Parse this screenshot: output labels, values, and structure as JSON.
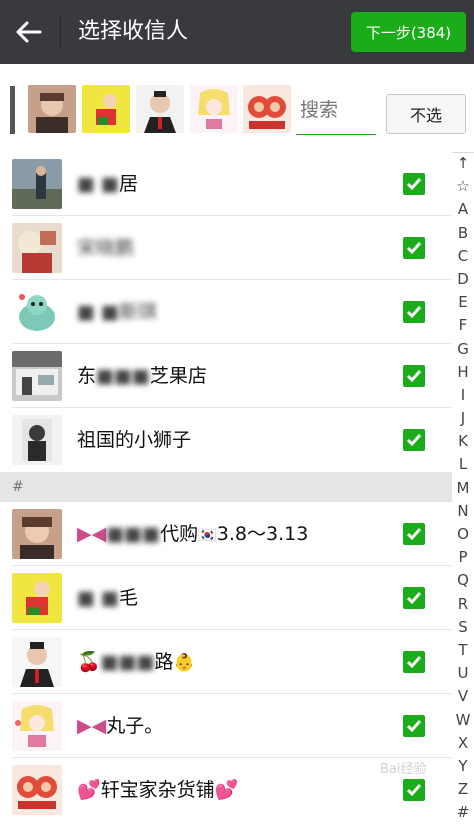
{
  "header": {
    "back_icon": "back-arrow-icon",
    "title": "选择收信人",
    "next_label": "下一步(384)"
  },
  "selected_bar": {
    "search_placeholder": "搜索",
    "deselect_label": "不选"
  },
  "contacts_top": [
    {
      "name": "██居",
      "checked": true
    },
    {
      "name": "宋晓鹏",
      "checked": true
    },
    {
      "name": "██斯琪",
      "checked": true
    },
    {
      "name": "东███芝果店",
      "checked": true
    },
    {
      "name": "祖国的小狮子",
      "checked": true
    }
  ],
  "section_header": "#",
  "contacts_hash": [
    {
      "name": "███代购🇰🇷3.8～3.13",
      "checked": true
    },
    {
      "name": "██毛",
      "checked": true
    },
    {
      "name": "███路👶",
      "checked": true
    },
    {
      "name": "█丸子。",
      "checked": true
    },
    {
      "name": "💕轩宝家杂货铺💕",
      "checked": true
    }
  ],
  "index_letters": [
    "↑",
    "☆",
    "A",
    "B",
    "C",
    "D",
    "E",
    "F",
    "G",
    "H",
    "I",
    "J",
    "K",
    "L",
    "M",
    "N",
    "O",
    "P",
    "Q",
    "R",
    "S",
    "T",
    "U",
    "V",
    "W",
    "X",
    "Y",
    "Z",
    "#"
  ],
  "watermark": "Bai经验",
  "colors": {
    "titlebar": "#393a3e",
    "accent_green": "#1aad19",
    "section_bg": "#e5e5e5"
  }
}
